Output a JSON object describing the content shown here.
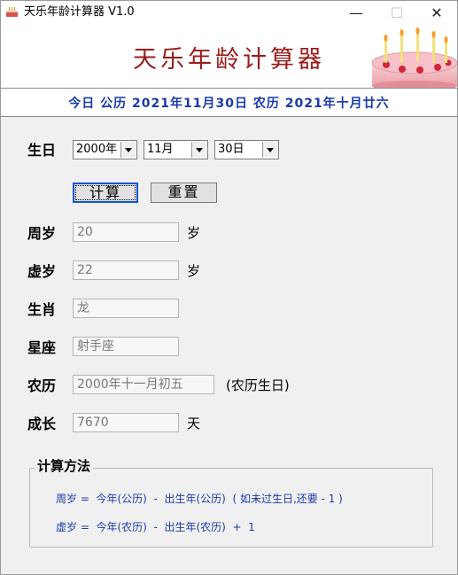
{
  "window": {
    "title": "天乐年龄计算器 V1.0",
    "minimize": "—",
    "maximize": "☐",
    "close": "✕"
  },
  "banner": {
    "title": "天乐年龄计算器"
  },
  "dateline": "今日 公历 2021年11月30日 农历 2021年十月廿六",
  "birthday": {
    "label": "生日",
    "year": "2000年",
    "month": "11月",
    "day": "30日"
  },
  "buttons": {
    "calculate": "计算",
    "reset": "重置"
  },
  "results": {
    "zhousui": {
      "label": "周岁",
      "value": "20",
      "unit": "岁"
    },
    "xusui": {
      "label": "虚岁",
      "value": "22",
      "unit": "岁"
    },
    "zodiac": {
      "label": "生肖",
      "value": "龙"
    },
    "constellation": {
      "label": "星座",
      "value": "射手座"
    },
    "lunar": {
      "label": "农历",
      "value": "2000年十一月初五",
      "note": "(农历生日)"
    },
    "growth": {
      "label": "成长",
      "value": "7670",
      "unit": "天"
    }
  },
  "method": {
    "title": "计算方法",
    "line1": "周岁 =  今年(公历)  -  出生年(公历)  ( 如未过生日,还要 - 1 )",
    "line2": "虚岁 =  今年(农历)  -  出生年(农历)  +  1"
  },
  "colors": {
    "banner_title": "#9a1b1b",
    "dateline": "#1a3aa8",
    "formula": "#1a3aa8"
  }
}
